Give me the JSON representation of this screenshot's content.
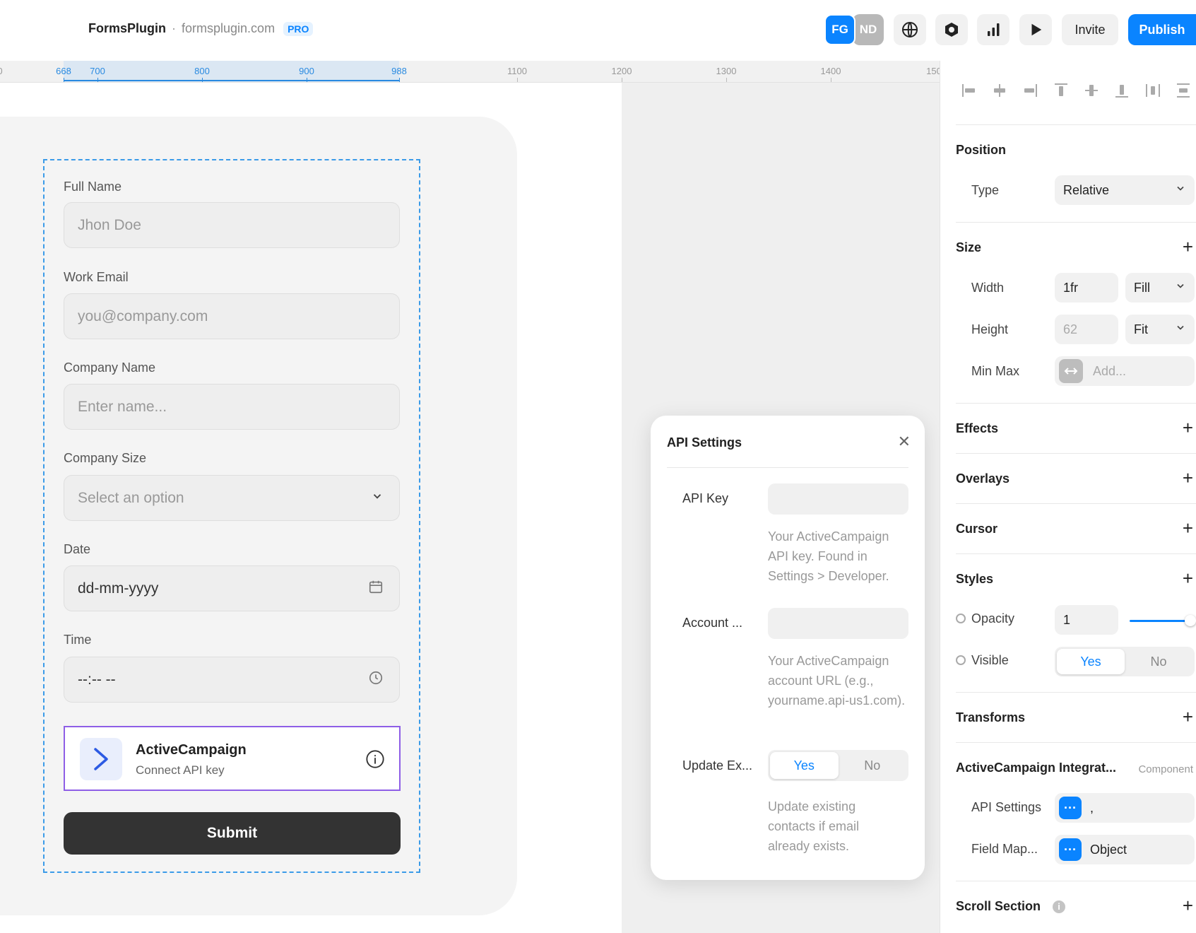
{
  "topbar": {
    "app_name": "FormsPlugin",
    "separator": "·",
    "domain": "formsplugin.com",
    "badge": "PRO",
    "avatars": [
      "FG",
      "ND"
    ],
    "icons": [
      "globe-icon",
      "hexagon-icon",
      "bar-chart-icon",
      "play-icon"
    ],
    "invite_label": "Invite",
    "publish_label": "Publish"
  },
  "ruler": {
    "ticks": [
      "0",
      "668",
      "700",
      "800",
      "900",
      "988",
      "1100",
      "1200",
      "1300",
      "1400",
      "150"
    ],
    "highlight_color": "#2a8ae0"
  },
  "form": {
    "full_name_label": "Full Name",
    "full_name_placeholder": "Jhon Doe",
    "email_label": "Work Email",
    "email_placeholder": "you@company.com",
    "company_label": "Company Name",
    "company_placeholder": "Enter name...",
    "size_label": "Company Size",
    "size_placeholder": "Select an option",
    "date_label": "Date",
    "date_value": "dd-mm-yyyy",
    "time_label": "Time",
    "time_value": "--:-- --",
    "integration_title": "ActiveCampaign",
    "integration_subtitle": "Connect API key",
    "submit_label": "Submit"
  },
  "api_modal": {
    "title": "API Settings",
    "close_icon": "close-icon",
    "api_key_label": "API Key",
    "api_key_value": "",
    "api_key_help": "Your ActiveCampaign API key. Found in Settings > Developer.",
    "account_label": "Account ...",
    "account_value": "",
    "account_help": "Your ActiveCampaign account URL (e.g., yourname.api-us1.com).",
    "update_label": "Update Ex...",
    "yes": "Yes",
    "no": "No",
    "update_help": "Update existing contacts if email already exists."
  },
  "panel": {
    "position_title": "Position",
    "type_label": "Type",
    "type_value": "Relative",
    "size_title": "Size",
    "width_label": "Width",
    "width_value": "1fr",
    "width_mode": "Fill",
    "height_label": "Height",
    "height_value": "62",
    "height_mode": "Fit",
    "minmax_label": "Min Max",
    "minmax_placeholder": "Add...",
    "effects_title": "Effects",
    "overlays_title": "Overlays",
    "cursor_title": "Cursor",
    "styles_title": "Styles",
    "opacity_label": "Opacity",
    "opacity_value": "1",
    "opacity_level": 1,
    "visible_label": "Visible",
    "visible_yes": "Yes",
    "visible_no": "No",
    "transforms_title": "Transforms",
    "component_title": "ActiveCampaign Integrat...",
    "component_tag": "Component",
    "api_settings_label": "API Settings",
    "api_settings_value": ",",
    "field_map_label": "Field Map...",
    "field_map_value": "Object",
    "scroll_title": "Scroll Section",
    "plus": "+"
  },
  "colors": {
    "accent": "#0a84ff",
    "selection": "#3b9be8",
    "integration_border": "#8e5ee6",
    "submit_bg": "#333333"
  }
}
